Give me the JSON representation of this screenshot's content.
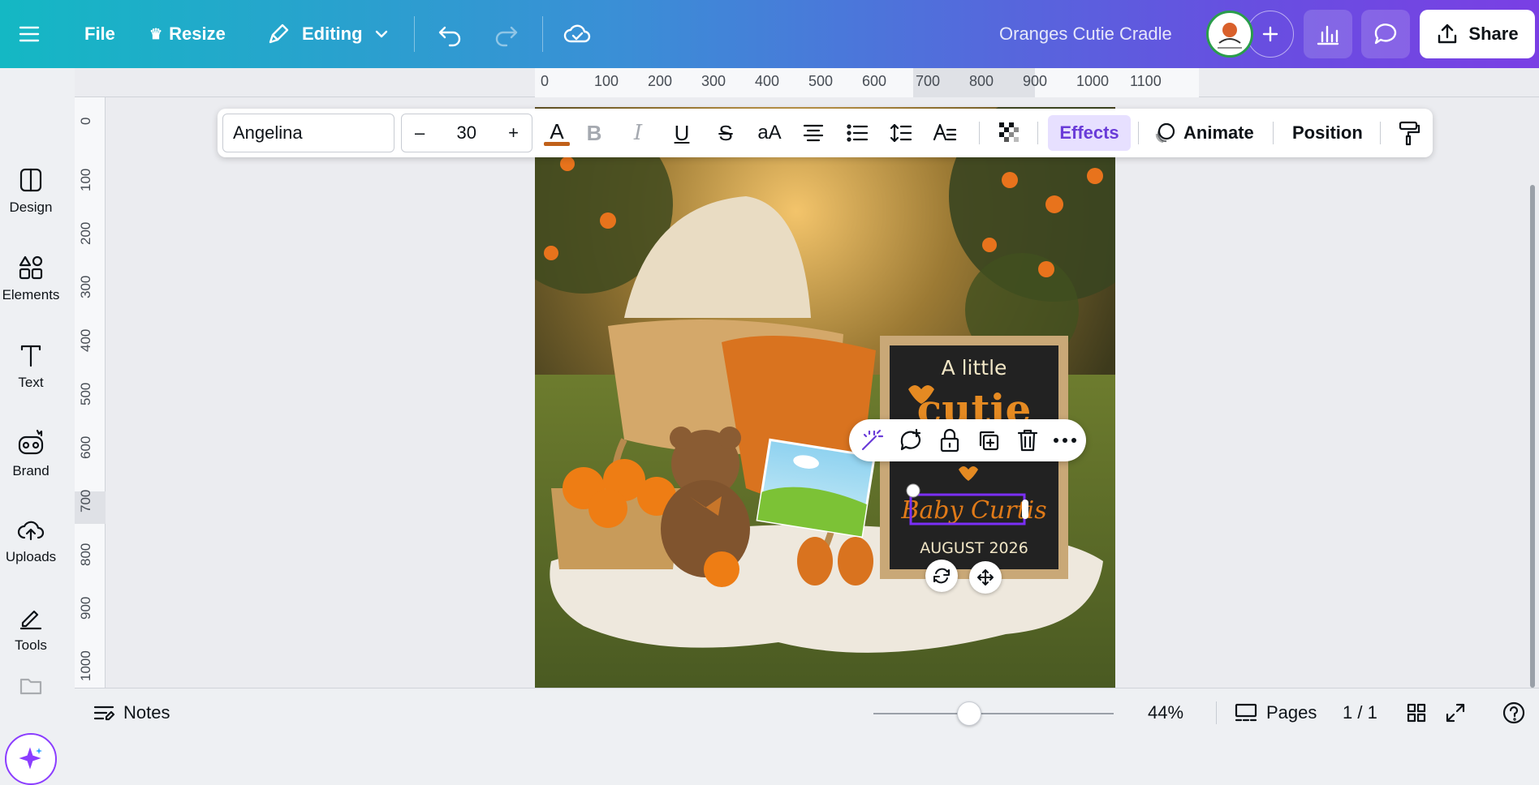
{
  "topbar": {
    "file_label": "File",
    "resize_label": "Resize",
    "editing_label": "Editing",
    "doc_title": "Oranges Cutie Cradle",
    "share_label": "Share"
  },
  "sidebar": {
    "items": [
      {
        "label": "Design",
        "icon": "design-icon"
      },
      {
        "label": "Elements",
        "icon": "elements-icon"
      },
      {
        "label": "Text",
        "icon": "text-icon"
      },
      {
        "label": "Brand",
        "icon": "brand-icon"
      },
      {
        "label": "Uploads",
        "icon": "uploads-icon"
      },
      {
        "label": "Tools",
        "icon": "tools-icon"
      }
    ]
  },
  "ruler": {
    "horizontal": [
      "0",
      "100",
      "200",
      "300",
      "400",
      "500",
      "600",
      "700",
      "800",
      "900",
      "1000",
      "1100"
    ],
    "vertical": [
      "0",
      "100",
      "200",
      "300",
      "400",
      "500",
      "600",
      "700",
      "800",
      "900",
      "1000"
    ]
  },
  "text_toolbar": {
    "font_name": "Angelina",
    "font_size": "30",
    "minus": "–",
    "plus": "+",
    "effects_label": "Effects",
    "animate_label": "Animate",
    "position_label": "Position",
    "text_color": "#c0601a"
  },
  "canvas": {
    "sign_line1": "A little",
    "sign_line2": "cutie",
    "sign_name": "Baby Curtis",
    "sign_date": "AUGUST 2026"
  },
  "bottombar": {
    "notes_label": "Notes",
    "zoom": "44%",
    "zoom_fraction": 0.4,
    "pages_label": "Pages",
    "page_count": "1 / 1"
  },
  "colors": {
    "accent": "#8b3dff",
    "effects_bg": "#e7e0ff"
  }
}
